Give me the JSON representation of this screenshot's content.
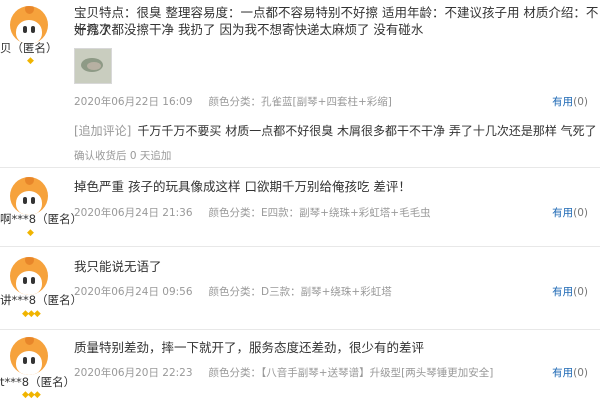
{
  "reviews": [
    {
      "user": "贝（匿名）",
      "badge": "◆",
      "text_line1": "宝贝特点：很臭  整理容易度：一点都不容易特别不好擦  适用年龄：不建议孩子用  材质介绍：不好擦了",
      "text_line2": "十几次都没擦干净  我扔了  因为我不想寄快递太麻烦了  没有碰水",
      "date": "2020年06月22日 16:09",
      "sku": "颜色分类：孔雀蓝[副琴+四套柱+彩缩]",
      "useful": "有用",
      "count": "(0)",
      "append_tag": "[追加评论]",
      "append_text": "千万千万不要买  材质一点都不好很臭  木屑很多都干不干净  弄了十几次还是那样  气死了",
      "append_meta": "确认收货后 0 天追加"
    },
    {
      "user": "啊***8（匿名）",
      "badge": "◆",
      "text": "掉色严重  孩子的玩具像成这样  口欲期千万别给俺孩吃  差评！",
      "date": "2020年06月24日 21:36",
      "sku": "颜色分类：E四款：副琴+绕珠+彩虹塔+毛毛虫",
      "useful": "有用",
      "count": "(0)"
    },
    {
      "user": "讲***8（匿名）",
      "badge": "◆◆◆",
      "text": "我只能说无语了",
      "date": "2020年06月24日 09:56",
      "sku": "颜色分类：D三款：副琴+绕珠+彩虹塔",
      "useful": "有用",
      "count": "(0)"
    },
    {
      "user": "t***8（匿名）",
      "badge": "◆◆◆",
      "text": "质量特别差劲，摔一下就开了，服务态度还差劲，很少有的差评",
      "date": "2020年06月20日 22:23",
      "sku": "颜色分类：【八音手副琴+送琴谱】升级型[两头琴锤更加安全]",
      "useful": "有用",
      "count": "(0)"
    }
  ],
  "colors": {
    "accent": "#1a66b3",
    "avatar": "#f6a23c",
    "badge": "#f0b400",
    "meta": "#999999"
  }
}
